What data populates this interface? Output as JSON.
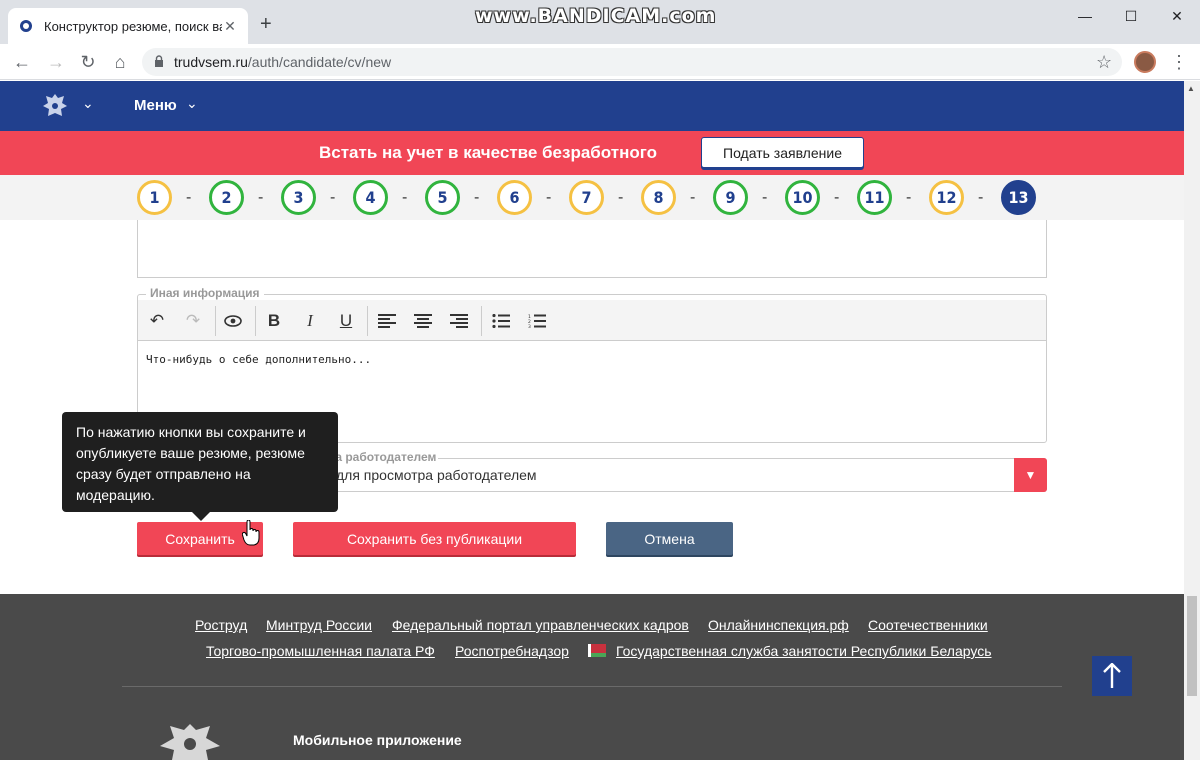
{
  "browser": {
    "tab_title": "Конструктор резюме, поиск вак",
    "new_tab": "+",
    "watermark": "www.BANDICAM.com",
    "url_host": "trudvsem.ru",
    "url_path": "/auth/candidate/cv/new"
  },
  "header": {
    "menu_label": "Меню"
  },
  "banner": {
    "text": "Встать на учет в качестве безработного",
    "button": "Подать заявление"
  },
  "steps": [
    {
      "label": "1",
      "state": "yellow"
    },
    {
      "label": "2",
      "state": "green"
    },
    {
      "label": "3",
      "state": "green"
    },
    {
      "label": "4",
      "state": "green"
    },
    {
      "label": "5",
      "state": "green"
    },
    {
      "label": "6",
      "state": "yellow"
    },
    {
      "label": "7",
      "state": "yellow"
    },
    {
      "label": "8",
      "state": "yellow"
    },
    {
      "label": "9",
      "state": "green"
    },
    {
      "label": "10",
      "state": "green"
    },
    {
      "label": "11",
      "state": "green"
    },
    {
      "label": "12",
      "state": "yellow"
    },
    {
      "label": "13",
      "state": "active"
    }
  ],
  "step_separator": "-",
  "form": {
    "other_info_legend": "Иная информация",
    "editor_text": "Что-нибудь о себе дополнительно...",
    "select_legend": "ра работодателем",
    "select_value": "для просмотра работодателем"
  },
  "tooltip": {
    "text": "По нажатию кнопки вы сохраните и опубликуете ваше резюме, резюме сразу будет отправлено на модерацию."
  },
  "buttons": {
    "save": "Сохранить",
    "save_no_publish": "Сохранить без публикации",
    "cancel": "Отмена"
  },
  "footer": {
    "links_row1": [
      "Роструд",
      "Минтруд России",
      "Федеральный портал управленческих кадров",
      "Онлайнинспекция.рф",
      "Соотечественники"
    ],
    "links_row2": [
      "Торгово-промышленная палата РФ",
      "Роспотребнадзор",
      "Государственная служба занятости Республики Беларусь"
    ],
    "mobile_app": "Мобильное приложение"
  },
  "colors": {
    "brand_blue": "#21408e",
    "accent_red": "#f14656",
    "step_yellow": "#f5c143",
    "step_green": "#31b43e",
    "cancel_blue": "#4a6584",
    "footer_bg": "#4a4a4a"
  }
}
